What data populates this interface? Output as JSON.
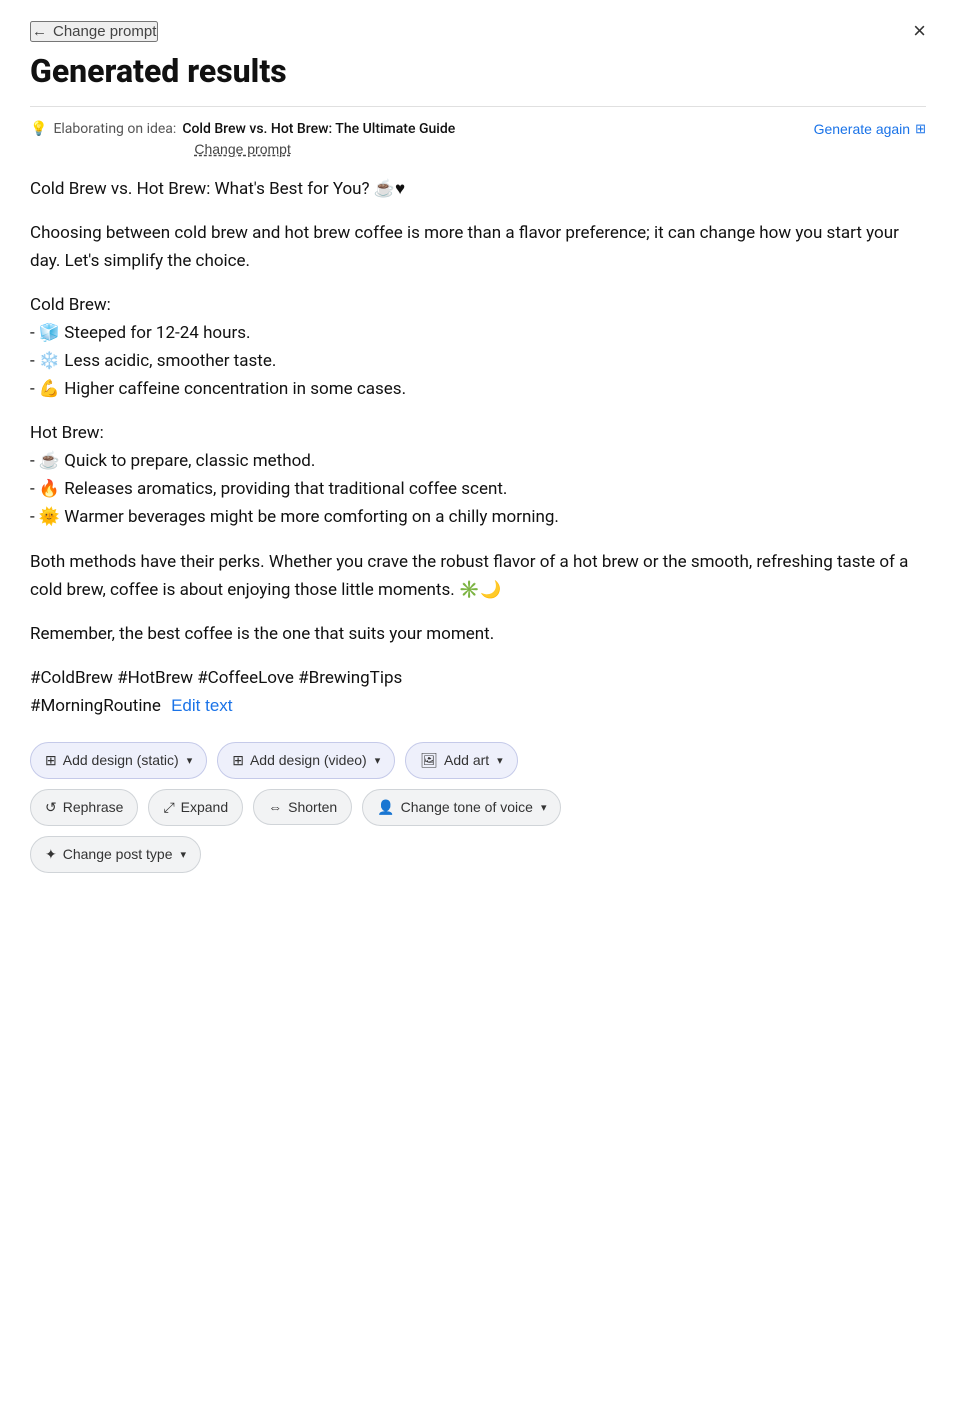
{
  "nav": {
    "back_label": "Change prompt",
    "close_label": "×"
  },
  "header": {
    "title": "Generated results"
  },
  "meta": {
    "elaborating_prefix": "Elaborating on idea:",
    "idea_title": "Cold Brew vs. Hot Brew: The Ultimate Guide",
    "change_prompt": "Change prompt",
    "generate_again": "Generate again"
  },
  "content": {
    "headline": "Cold Brew vs. Hot Brew: What's Best for You? ☕♥",
    "para1": "Choosing between cold brew and hot brew coffee is more than a flavor preference; it can change how you start your day. Let's simplify the choice.",
    "cold_brew_title": "Cold Brew:",
    "cold_brew_items": [
      "- 🧊 Steeped for 12-24 hours.",
      "- ❄️ Less acidic, smoother taste.",
      "- 💪 Higher caffeine concentration in some cases."
    ],
    "hot_brew_title": "Hot Brew:",
    "hot_brew_items": [
      "- ☕ Quick to prepare, classic method.",
      "- 🔥 Releases aromatics, providing that traditional coffee scent.",
      "- 🌞 Warmer beverages might be more comforting on a chilly morning."
    ],
    "para_both": "Both methods have their perks. Whether you crave the robust flavor of a hot brew or the smooth, refreshing taste of a cold brew, coffee is about enjoying those little moments. ✳️🌙",
    "para_remember": "Remember, the best coffee is the one that suits your moment.",
    "hashtags": "#ColdBrew #HotBrew #CoffeeLove #BrewingTips\n#MorningRoutine",
    "edit_text": "Edit text"
  },
  "action_buttons": {
    "row1": [
      {
        "icon": "🖼",
        "label": "Add design (static)",
        "has_dropdown": true
      },
      {
        "icon": "🎬",
        "label": "Add design (video)",
        "has_dropdown": true
      },
      {
        "icon": "🖼",
        "label": "Add art",
        "has_dropdown": true
      }
    ],
    "row2": [
      {
        "icon": "↺",
        "label": "Rephrase",
        "has_dropdown": false
      },
      {
        "icon": "⤢",
        "label": "Expand",
        "has_dropdown": false
      },
      {
        "icon": "⇔",
        "label": "Shorten",
        "has_dropdown": false
      },
      {
        "icon": "👤",
        "label": "Change tone of voice",
        "has_dropdown": true
      }
    ],
    "row3": [
      {
        "icon": "✦",
        "label": "Change post type",
        "has_dropdown": true
      }
    ]
  }
}
